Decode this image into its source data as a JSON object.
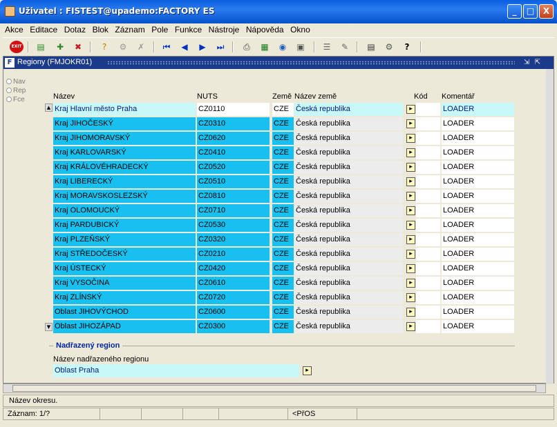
{
  "window": {
    "title": "Uživatel : FISTEST@upademo:FACTORY ES",
    "minimize": "_",
    "maximize": "□",
    "close": "X"
  },
  "menu": [
    "Akce",
    "Editace",
    "Dotaz",
    "Blok",
    "Záznam",
    "Pole",
    "Funkce",
    "Nástroje",
    "Nápověda",
    "Okno"
  ],
  "toolbar": {
    "exit": "EXIT",
    "icons": [
      "save-icon",
      "add-record-icon",
      "delete-record-icon",
      "query-icon",
      "enter-query-icon",
      "cancel-query-icon",
      "first-record-icon",
      "prev-record-icon",
      "next-record-icon",
      "last-record-icon",
      "print-icon",
      "excel-icon",
      "web-icon",
      "calculator-icon",
      "list-icon",
      "edit-icon",
      "notes-icon",
      "settings-icon",
      "help-icon"
    ]
  },
  "form": {
    "title": "Regiony (FMJOKR01)"
  },
  "radios": [
    "Nav",
    "Rep",
    "Fce"
  ],
  "columns": {
    "nazev": "Název",
    "nuts": "NUTS",
    "zeme": "Země",
    "nazev_zeme": "Název země",
    "kod": "Kód",
    "komentar": "Komentář"
  },
  "rows": [
    {
      "nazev": "Kraj Hlavní město Praha",
      "nuts": "CZ0110",
      "zeme": "CZE",
      "nazev_zeme": "Česká republika",
      "komentar": "LOADER"
    },
    {
      "nazev": "Kraj JIHOČESKÝ",
      "nuts": "CZ0310",
      "zeme": "CZE",
      "nazev_zeme": "Česká republika",
      "komentar": "LOADER"
    },
    {
      "nazev": "Kraj JIHOMORAVSKÝ",
      "nuts": "CZ0620",
      "zeme": "CZE",
      "nazev_zeme": "Česká republika",
      "komentar": "LOADER"
    },
    {
      "nazev": "Kraj KARLOVARSKÝ",
      "nuts": "CZ0410",
      "zeme": "CZE",
      "nazev_zeme": "Česká republika",
      "komentar": "LOADER"
    },
    {
      "nazev": "Kraj KRÁLOVÉHRADECKÝ",
      "nuts": "CZ0520",
      "zeme": "CZE",
      "nazev_zeme": "Česká republika",
      "komentar": "LOADER"
    },
    {
      "nazev": "Kraj LIBERECKÝ",
      "nuts": "CZ0510",
      "zeme": "CZE",
      "nazev_zeme": "Česká republika",
      "komentar": "LOADER"
    },
    {
      "nazev": "Kraj MORAVSKOSLEZSKÝ",
      "nuts": "CZ0810",
      "zeme": "CZE",
      "nazev_zeme": "Česká republika",
      "komentar": "LOADER"
    },
    {
      "nazev": "Kraj OLOMOUCKÝ",
      "nuts": "CZ0710",
      "zeme": "CZE",
      "nazev_zeme": "Česká republika",
      "komentar": "LOADER"
    },
    {
      "nazev": "Kraj PARDUBICKÝ",
      "nuts": "CZ0530",
      "zeme": "CZE",
      "nazev_zeme": "Česká republika",
      "komentar": "LOADER"
    },
    {
      "nazev": "Kraj PLZEŇSKÝ",
      "nuts": "CZ0320",
      "zeme": "CZE",
      "nazev_zeme": "Česká republika",
      "komentar": "LOADER"
    },
    {
      "nazev": "Kraj STŘEDOČESKÝ",
      "nuts": "CZ0210",
      "zeme": "CZE",
      "nazev_zeme": "Česká republika",
      "komentar": "LOADER"
    },
    {
      "nazev": "Kraj ÚSTECKÝ",
      "nuts": "CZ0420",
      "zeme": "CZE",
      "nazev_zeme": "Česká republika",
      "komentar": "LOADER"
    },
    {
      "nazev": "Kraj VYSOČINA",
      "nuts": "CZ0610",
      "zeme": "CZE",
      "nazev_zeme": "Česká republika",
      "komentar": "LOADER"
    },
    {
      "nazev": "Kraj ZLÍNSKÝ",
      "nuts": "CZ0720",
      "zeme": "CZE",
      "nazev_zeme": "Česká republika",
      "komentar": "LOADER"
    },
    {
      "nazev": "Oblast JIHOVÝCHOD",
      "nuts": "CZ0600",
      "zeme": "CZE",
      "nazev_zeme": "Česká republika",
      "komentar": "LOADER"
    },
    {
      "nazev": "Oblast JIHOZÁPAD",
      "nuts": "CZ0300",
      "zeme": "CZE",
      "nazev_zeme": "Česká republika",
      "komentar": "LOADER"
    }
  ],
  "parent": {
    "section": "Nadřazený region",
    "label": "Název nadřazeného regionu",
    "value": "Oblast Praha"
  },
  "status": {
    "hint": "Název okresu.",
    "record": "Záznam: 1/?",
    "mode": "<PřOS"
  },
  "colors": {
    "cyan": "#18c0f0",
    "current": "#c8f8f8",
    "titlebar": "#0a5fde"
  }
}
